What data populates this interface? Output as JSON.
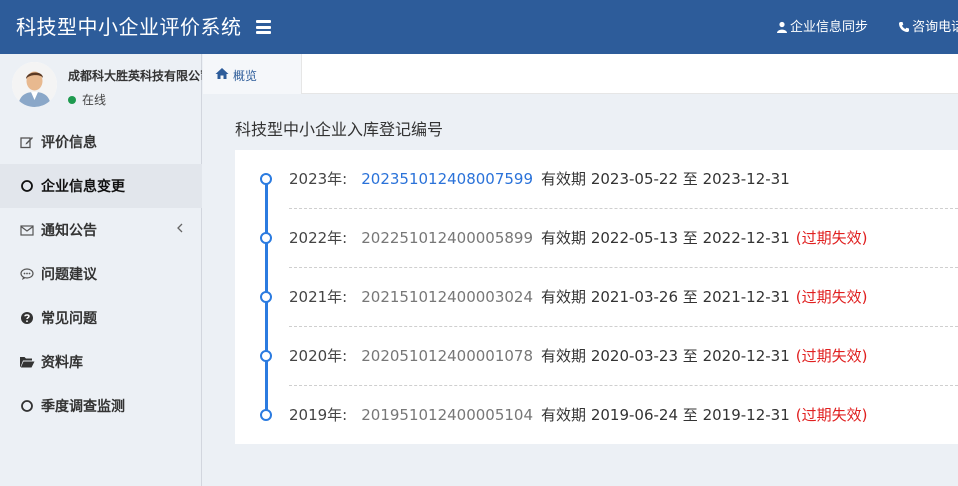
{
  "app": {
    "title": "科技型中小企业评价系统"
  },
  "header": {
    "actions": [
      {
        "icon": "user-icon",
        "label": "企业信息同步"
      },
      {
        "icon": "phone-icon",
        "label": "咨询电话"
      }
    ]
  },
  "user": {
    "name": "成都科大胜英科技有限公司",
    "status": "在线"
  },
  "sidebar": {
    "items": [
      {
        "icon": "edit-icon",
        "label": "评价信息"
      },
      {
        "icon": "circle-icon",
        "label": "企业信息变更",
        "active": true
      },
      {
        "icon": "envelope-icon",
        "label": "通知公告"
      },
      {
        "icon": "comment-icon",
        "label": "问题建议"
      },
      {
        "icon": "question-circle-icon",
        "label": "常见问题"
      },
      {
        "icon": "folder-open-icon",
        "label": "资料库"
      },
      {
        "icon": "circle-icon",
        "label": "季度调查监测"
      }
    ]
  },
  "tabs": [
    {
      "icon": "home-icon",
      "label": "概览"
    }
  ],
  "main": {
    "title": "科技型中小企业入库登记编号",
    "valid_label": "有效期",
    "to_label": "至",
    "records": [
      {
        "year": "2023年:",
        "code": "202351012408007599",
        "start": "2023-05-22",
        "end": "2023-12-31",
        "status": ""
      },
      {
        "year": "2022年:",
        "code": "202251012400005899",
        "start": "2022-05-13",
        "end": "2022-12-31",
        "status": "(过期失效)"
      },
      {
        "year": "2021年:",
        "code": "202151012400003024",
        "start": "2021-03-26",
        "end": "2021-12-31",
        "status": "(过期失效)"
      },
      {
        "year": "2020年:",
        "code": "202051012400001078",
        "start": "2020-03-23",
        "end": "2020-12-31",
        "status": "(过期失效)"
      },
      {
        "year": "2019年:",
        "code": "201951012400005104",
        "start": "2019-06-24",
        "end": "2019-12-31",
        "status": "(过期失效)"
      }
    ]
  },
  "colors": {
    "header_bg": "#2d5c9a",
    "link_blue": "#2a72d9",
    "timeline_blue": "#2b7be0",
    "expired_red": "#e02020",
    "online_green": "#1e9a4f"
  }
}
